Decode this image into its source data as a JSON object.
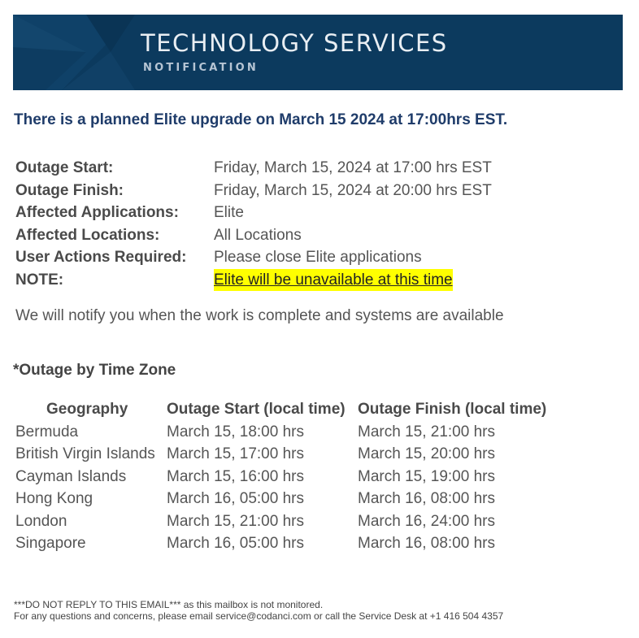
{
  "banner": {
    "title": "TECHNOLOGY SERVICES",
    "subtitle": "NOTIFICATION",
    "background_color": "#0c3a5e"
  },
  "headline": "There is a planned Elite upgrade on March 15 2024 at 17:00hrs EST.",
  "details": [
    {
      "label": "Outage Start:",
      "value": "Friday, March 15, 2024 at 17:00 hrs EST"
    },
    {
      "label": "Outage Finish:",
      "value": "Friday, March 15, 2024 at 20:00 hrs EST"
    },
    {
      "label": "Affected Applications:",
      "value": "Elite"
    },
    {
      "label": "Affected Locations:",
      "value": "All Locations"
    },
    {
      "label": "User Actions Required:",
      "value": "Please close Elite applications"
    },
    {
      "label": "NOTE:",
      "value": "Elite will be unavailable at this time"
    }
  ],
  "notify_text": "We will notify you when the work is complete and systems are available",
  "timezone_heading": "*Outage by Time Zone",
  "timezone_table": {
    "headers": [
      "Geography",
      "Outage Start (local time)",
      "Outage Finish (local time)"
    ],
    "rows": [
      [
        "Bermuda",
        "March 15, 18:00 hrs",
        "March 15, 21:00 hrs"
      ],
      [
        "British Virgin Islands",
        "March 15, 17:00 hrs",
        "March 15, 20:00 hrs"
      ],
      [
        "Cayman Islands",
        "March 15, 16:00 hrs",
        "March 15, 19:00 hrs"
      ],
      [
        "Hong Kong",
        "March 16, 05:00 hrs",
        "March 16, 08:00 hrs"
      ],
      [
        "London",
        "March 15, 21:00 hrs",
        "March 16, 24:00 hrs"
      ],
      [
        "Singapore",
        "March 16, 05:00 hrs",
        "March 16, 08:00 hrs"
      ]
    ]
  },
  "footer": {
    "warning": "***DO NOT REPLY TO THIS EMAIL***",
    "warning_suffix": " as this mailbox is not monitored.",
    "contact": "For any questions and concerns, please email service@codanci.com or call the Service Desk at +1 416 504 4357"
  },
  "colors": {
    "headline": "#1f3c6a",
    "highlight": "#ffff00"
  }
}
